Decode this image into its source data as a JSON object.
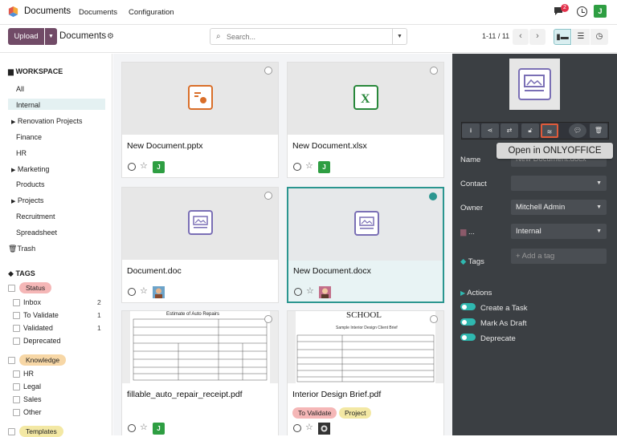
{
  "topbar": {
    "app_name": "Documents",
    "menu": [
      "Documents",
      "Configuration"
    ],
    "notif_count": "2",
    "user_initial": "J"
  },
  "control": {
    "upload_label": "Upload",
    "breadcrumb": "Documents",
    "search_placeholder": "Search...",
    "pager": "1-11 / 11"
  },
  "sidebar": {
    "workspace_title": "WORKSPACE",
    "folders": [
      "All",
      "Internal",
      "Renovation Projects",
      "Finance",
      "HR",
      "Marketing",
      "Products",
      "Projects",
      "Recruitment",
      "Spreadsheet"
    ],
    "trash_label": "Trash",
    "tags_title": "TAGS",
    "status_group": "Status",
    "status_tags": [
      {
        "label": "Inbox",
        "count": "2"
      },
      {
        "label": "To Validate",
        "count": "1"
      },
      {
        "label": "Validated",
        "count": "1"
      },
      {
        "label": "Deprecated",
        "count": ""
      }
    ],
    "knowledge_group": "Knowledge",
    "knowledge_tags": [
      "HR",
      "Legal",
      "Sales",
      "Other"
    ],
    "templates_group": "Templates"
  },
  "documents": [
    {
      "name": "New Document.pptx",
      "icon": "pptx-icon",
      "owner": "J"
    },
    {
      "name": "New Document.xlsx",
      "icon": "xlsx-icon",
      "owner": "J"
    },
    {
      "name": "Document.doc",
      "icon": "doc-icon",
      "owner": "avatar"
    },
    {
      "name": "New Document.docx",
      "icon": "doc-icon",
      "owner": "avatar",
      "selected": true
    },
    {
      "name": "fillable_auto_repair_receipt.pdf",
      "icon": "pdf-preview",
      "owner": "J",
      "preview_title": "Estimate of Auto Repairs"
    },
    {
      "name": "Interior Design Brief.pdf",
      "icon": "pdf-preview",
      "owner": "avatar",
      "preview_title": "SCHOOL",
      "preview_subtitle": "Sample Interior Design Client Brief",
      "tags": [
        "To Validate",
        "Project"
      ]
    }
  ],
  "panel": {
    "tooltip": "Open in ONLYOFFICE",
    "name_label": "Name",
    "name_value": "New Document.docx",
    "contact_label": "Contact",
    "owner_label": "Owner",
    "owner_value": "Mitchell Admin",
    "workspace_label": "...",
    "workspace_value": "Internal",
    "tags_label": "Tags",
    "tags_placeholder": "+ Add a tag",
    "actions_title": "Actions",
    "actions": [
      "Create a Task",
      "Mark As Draft",
      "Deprecate"
    ]
  },
  "colors": {
    "brand": "#714b67",
    "accent": "#2b9690",
    "panel": "#3b3f43",
    "status_pill": "#f5b7b7",
    "knowledge_pill": "#f7d7a6",
    "project_pill": "#f3e8a4",
    "toggle": "#2fb8b0"
  }
}
